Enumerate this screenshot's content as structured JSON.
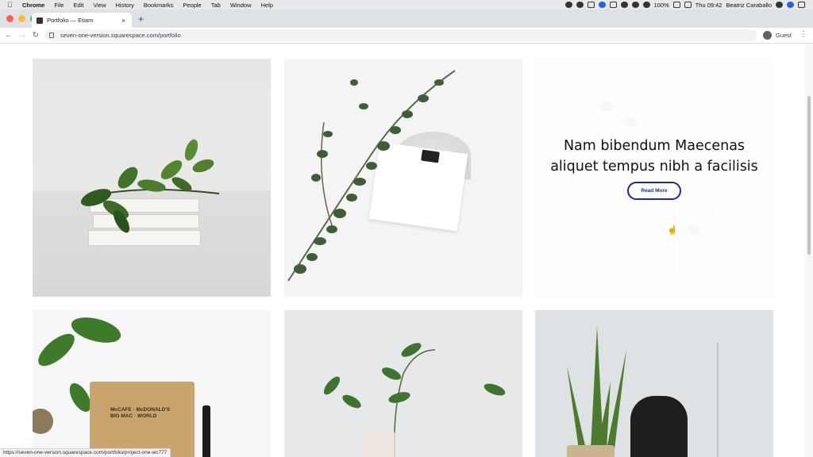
{
  "menubar": {
    "app": "Chrome",
    "items": [
      "File",
      "Edit",
      "View",
      "History",
      "Bookmarks",
      "People",
      "Tab",
      "Window",
      "Help"
    ],
    "battery": "100%",
    "clock": "Thu 09:42",
    "user": "Beatriz Caraballo"
  },
  "tab": {
    "title": "Portfolio — Etiam",
    "close": "×",
    "new_tab": "+"
  },
  "toolbar": {
    "url": "seven-one-version.squarespace.com/portfolio",
    "profile": "Guest"
  },
  "page": {
    "overlay_title": "Nam bibendum Maecenas aliquet tempus nibh a facilisis",
    "overlay_button": "Read More"
  },
  "statusbar": {
    "link": "https://seven-one-version.squarespace.com/portfolio/project-one-wc777"
  },
  "colors": {
    "accent": "#1f2a8f",
    "leaf": "#3f6b2a"
  }
}
